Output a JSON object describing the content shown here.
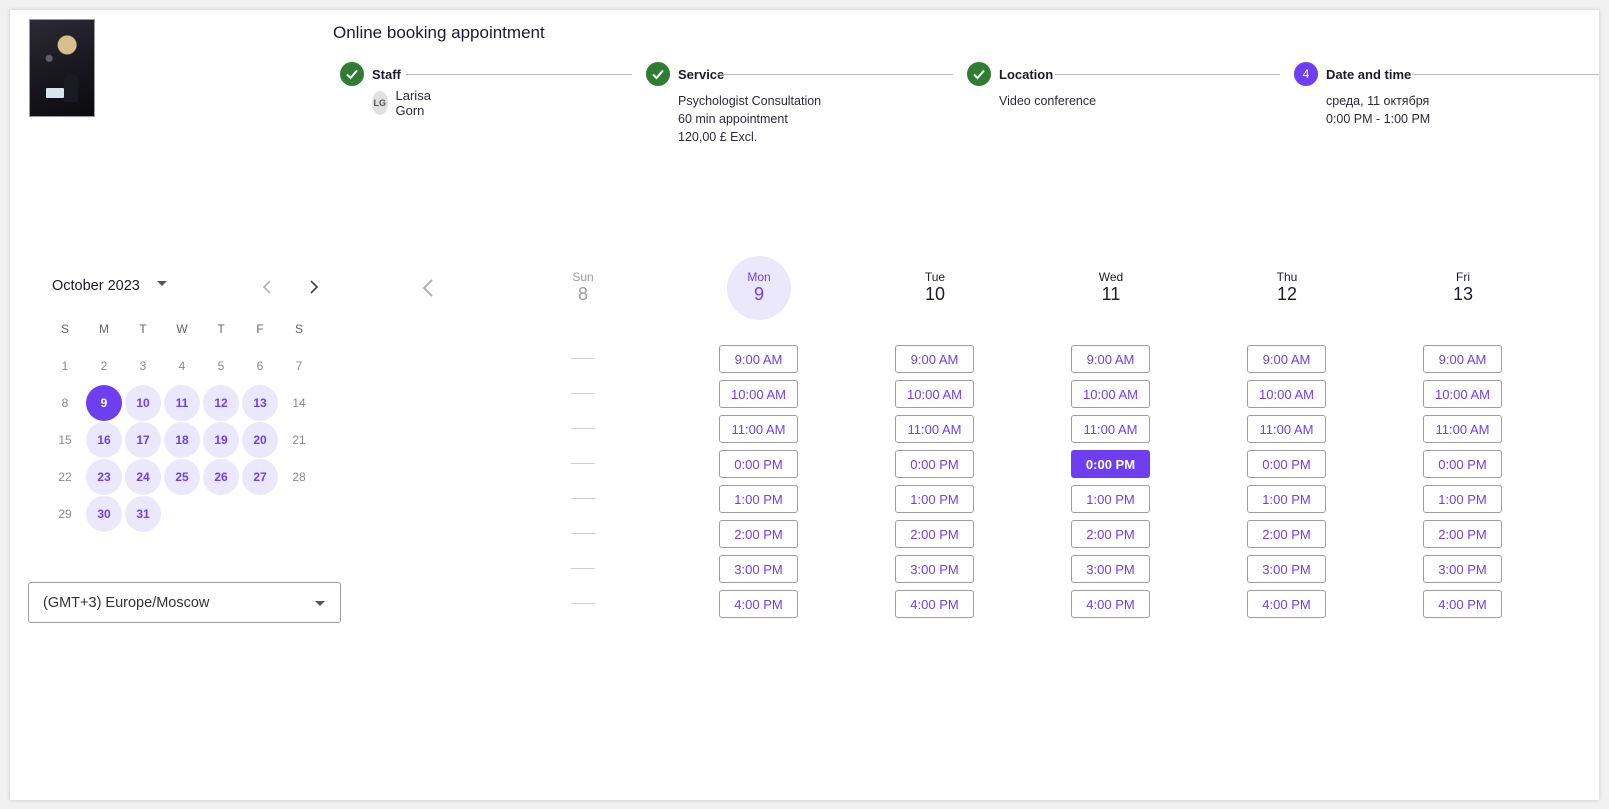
{
  "header": {
    "title": "Online booking appointment"
  },
  "steps": [
    {
      "label": "Staff",
      "state": "done",
      "avatar": "LG",
      "details": [
        "Larisa Gorn"
      ]
    },
    {
      "label": "Service",
      "state": "done",
      "details": [
        "Psychologist Consultation",
        "60 min appointment",
        "120,00 £ Excl."
      ]
    },
    {
      "label": "Location",
      "state": "done",
      "details": [
        "Video conference"
      ]
    },
    {
      "label": "Date and time",
      "state": "active",
      "number": "4",
      "details": [
        "среда, 11 октября",
        "0:00 PM - 1:00 PM"
      ]
    }
  ],
  "calendar": {
    "month_label": "October 2023",
    "weekdays": [
      "S",
      "M",
      "T",
      "W",
      "T",
      "F",
      "S"
    ],
    "weeks": [
      [
        {
          "d": "1",
          "s": "muted"
        },
        {
          "d": "2",
          "s": "muted"
        },
        {
          "d": "3",
          "s": "muted"
        },
        {
          "d": "4",
          "s": "muted"
        },
        {
          "d": "5",
          "s": "muted"
        },
        {
          "d": "6",
          "s": "muted"
        },
        {
          "d": "7",
          "s": "muted"
        }
      ],
      [
        {
          "d": "8",
          "s": "muted"
        },
        {
          "d": "9",
          "s": "selected"
        },
        {
          "d": "10",
          "s": "available"
        },
        {
          "d": "11",
          "s": "available"
        },
        {
          "d": "12",
          "s": "available"
        },
        {
          "d": "13",
          "s": "available"
        },
        {
          "d": "14",
          "s": "muted"
        }
      ],
      [
        {
          "d": "15",
          "s": "muted"
        },
        {
          "d": "16",
          "s": "available"
        },
        {
          "d": "17",
          "s": "available"
        },
        {
          "d": "18",
          "s": "available"
        },
        {
          "d": "19",
          "s": "available"
        },
        {
          "d": "20",
          "s": "available"
        },
        {
          "d": "21",
          "s": "muted"
        }
      ],
      [
        {
          "d": "22",
          "s": "muted"
        },
        {
          "d": "23",
          "s": "available"
        },
        {
          "d": "24",
          "s": "available"
        },
        {
          "d": "25",
          "s": "available"
        },
        {
          "d": "26",
          "s": "available"
        },
        {
          "d": "27",
          "s": "available"
        },
        {
          "d": "28",
          "s": "muted"
        }
      ],
      [
        {
          "d": "29",
          "s": "muted"
        },
        {
          "d": "30",
          "s": "available"
        },
        {
          "d": "31",
          "s": "available"
        }
      ]
    ]
  },
  "timezone": {
    "value": "(GMT+3) Europe/Moscow"
  },
  "week": {
    "days": [
      {
        "name": "Sun",
        "date": "8",
        "state": "muted"
      },
      {
        "name": "Mon",
        "date": "9",
        "state": "today"
      },
      {
        "name": "Tue",
        "date": "10",
        "state": "normal"
      },
      {
        "name": "Wed",
        "date": "11",
        "state": "normal"
      },
      {
        "name": "Thu",
        "date": "12",
        "state": "normal"
      },
      {
        "name": "Fri",
        "date": "13",
        "state": "normal"
      }
    ],
    "slots": [
      "9:00 AM",
      "10:00 AM",
      "11:00 AM",
      "0:00 PM",
      "1:00 PM",
      "2:00 PM",
      "3:00 PM",
      "4:00 PM"
    ],
    "selected_day": "11",
    "selected_slot": "0:00 PM"
  },
  "colors": {
    "accent": "#6e3ff0",
    "accent_light": "#ece8fb",
    "done": "#2e7d32"
  },
  "icons": {
    "step_done": "check-icon",
    "month_dropdown": "chevron-down-icon",
    "prev": "chevron-left-icon",
    "next": "chevron-right-icon"
  }
}
